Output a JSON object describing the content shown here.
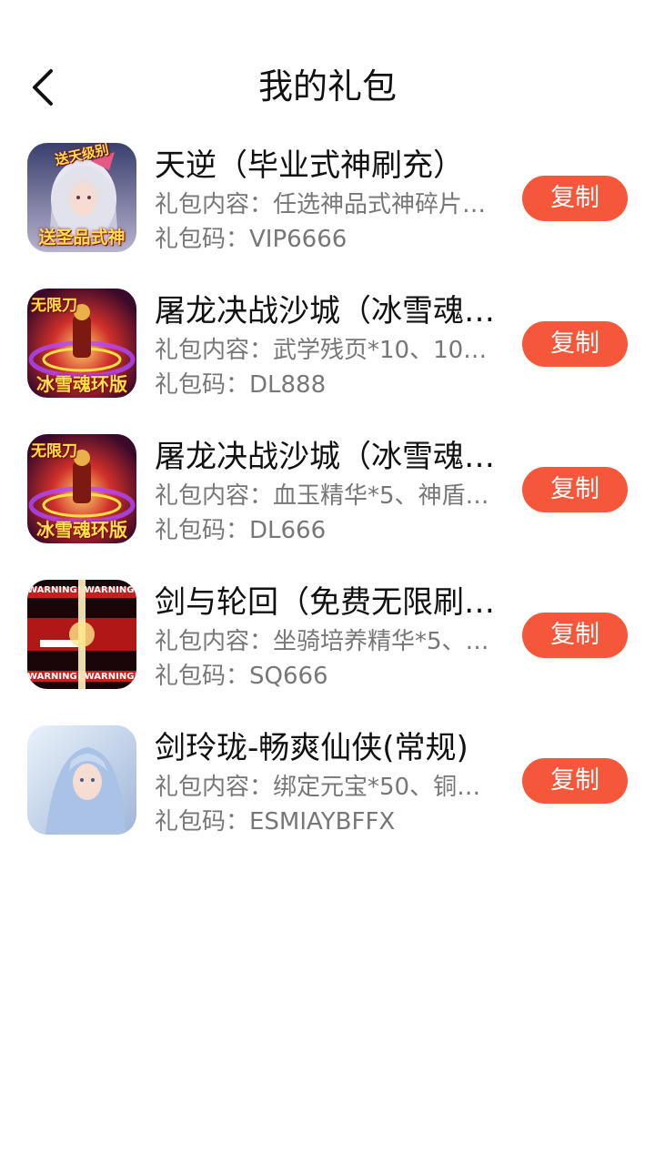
{
  "header": {
    "title": "我的礼包",
    "back_icon": "chevron-left-icon"
  },
  "colors": {
    "accent": "#f5573a",
    "text": "#111111",
    "subtext": "#777777"
  },
  "gifts": [
    {
      "name": "天逆（毕业式神刷充）",
      "content": "礼包内容：任选神品式神碎片…",
      "code": "礼包码：VIP6666",
      "copy_label": "复制",
      "thumb_top_text": "送天级别",
      "thumb_bottom_text": "送圣品式神"
    },
    {
      "name": "屠龙决战沙城（冰雪魂…",
      "content": "礼包内容：武学残页*10、10…",
      "code": "礼包码：DL888",
      "copy_label": "复制",
      "thumb_top_text": "无限刀",
      "thumb_bottom_text": "冰雪魂环版"
    },
    {
      "name": "屠龙决战沙城（冰雪魂…",
      "content": "礼包内容：血玉精华*5、神盾…",
      "code": "礼包码：DL666",
      "copy_label": "复制",
      "thumb_top_text": "无限刀",
      "thumb_bottom_text": "冰雪魂环版"
    },
    {
      "name": "剑与轮回（免费无限刷…",
      "content": "礼包内容：坐骑培养精华*5、…",
      "code": "礼包码：SQ666",
      "copy_label": "复制",
      "thumb_top_text": "WARNING! WARNING!",
      "thumb_bottom_text": "WARNING! WARNING!"
    },
    {
      "name": "剑玲珑-畅爽仙侠(常规)",
      "content": "礼包内容：绑定元宝*50、铜…",
      "code": "礼包码：ESMIAYBFFX",
      "copy_label": "复制"
    }
  ]
}
